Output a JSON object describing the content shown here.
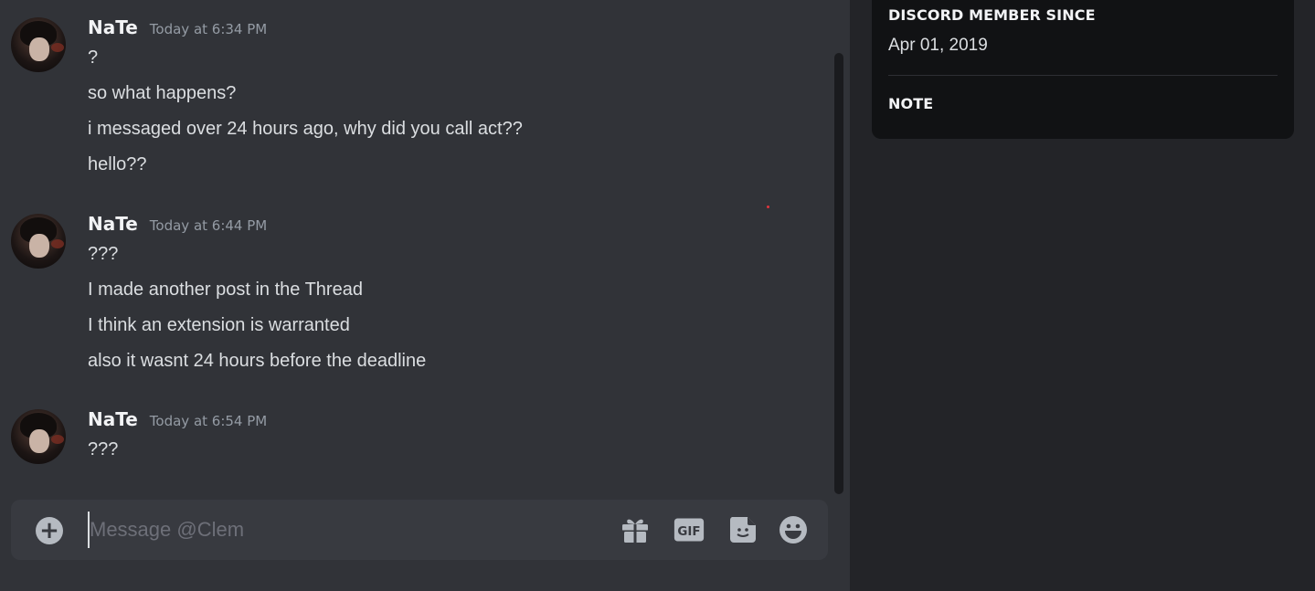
{
  "messages": [
    {
      "username": "NaTe",
      "timestamp": "Today at 6:34 PM",
      "lines": [
        "?",
        "so what happens?",
        "i messaged over 24 hours ago, why did you call act??",
        "hello??"
      ]
    },
    {
      "username": "NaTe",
      "timestamp": "Today at 6:44 PM",
      "lines": [
        "???",
        "I made another post in the Thread",
        "I think an extension is warranted",
        "also it wasnt 24 hours before the deadline"
      ]
    },
    {
      "username": "NaTe",
      "timestamp": "Today at 6:54 PM",
      "lines": [
        "???"
      ]
    }
  ],
  "composer": {
    "placeholder": "Message @Clem",
    "value": "",
    "gif_label": "GIF"
  },
  "profile": {
    "member_since_heading": "DISCORD MEMBER SINCE",
    "member_since_value": "Apr 01, 2019",
    "note_heading": "NOTE"
  },
  "colors": {
    "chat_bg": "#313338",
    "side_bg": "#232428",
    "card_bg": "#111214",
    "composer_bg": "#383a40",
    "icon": "#b5bac1"
  }
}
